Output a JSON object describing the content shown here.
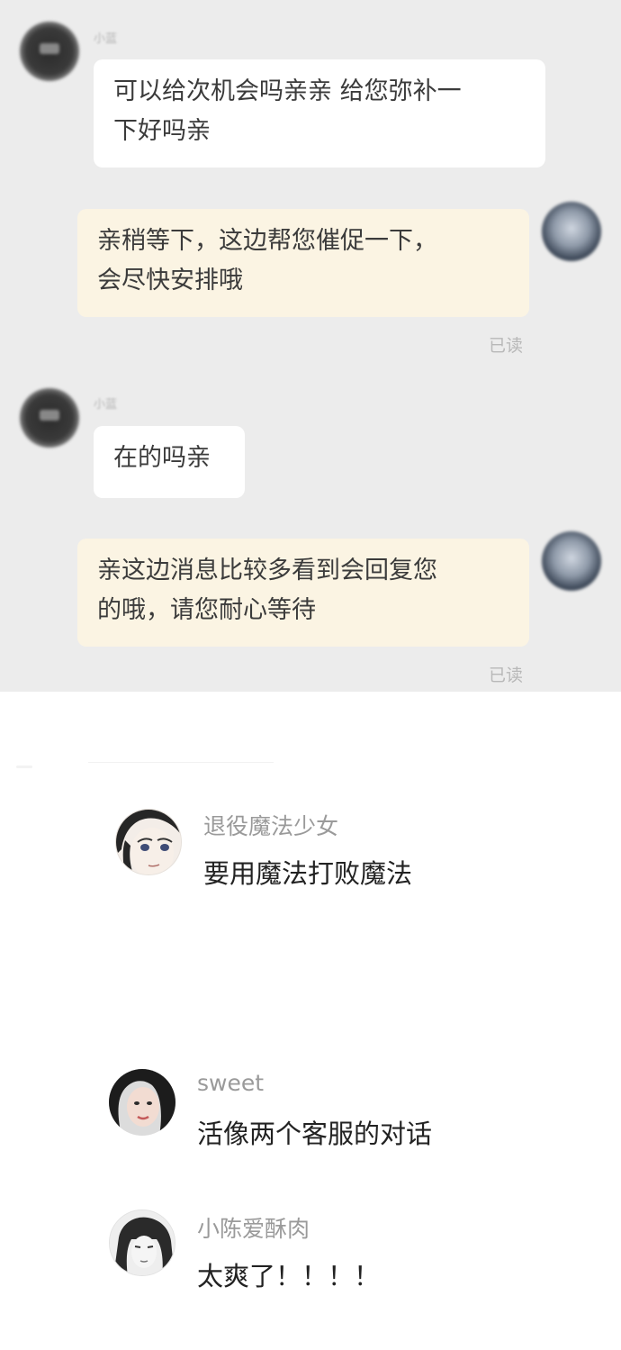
{
  "chat": {
    "messages": [
      {
        "direction": "in",
        "sender": "小蓝",
        "text_line1": "可以给次机会吗亲亲 给您弥补一",
        "text_line2": "下好吗亲"
      },
      {
        "direction": "out",
        "text_line1": "亲稍等下，这边帮您催促一下，",
        "text_line2": "会尽快安排哦",
        "status": "已读"
      },
      {
        "direction": "in",
        "sender": "小蓝",
        "text_line1": "在的吗亲"
      },
      {
        "direction": "out",
        "text_line1": "亲这边消息比较多看到会回复您",
        "text_line2": "的哦，请您耐心等待",
        "status": "已读"
      }
    ]
  },
  "comments": [
    {
      "username": "退役魔法少女",
      "text": "要用魔法打败魔法",
      "avatar_icon": "anime-girl-avatar"
    },
    {
      "username": "sweet",
      "text": "活像两个客服的对话",
      "avatar_icon": "woman-photo-avatar"
    },
    {
      "username": "小陈爱酥肉",
      "text": "太爽了！！！！",
      "avatar_icon": "sketch-character-avatar"
    }
  ]
}
